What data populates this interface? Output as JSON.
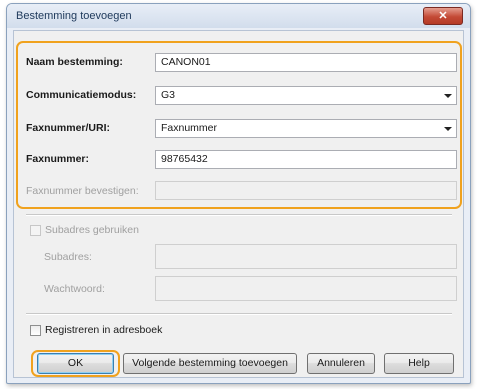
{
  "dialog": {
    "title": "Bestemming toevoegen",
    "close_label": "✕"
  },
  "form": {
    "name_label": "Naam bestemming:",
    "name_value": "CANON01",
    "mode_label": "Communicatiemodus:",
    "mode_value": "G3",
    "fax_uri_label": "Faxnummer/URI:",
    "fax_uri_value": "Faxnummer",
    "fax_label": "Faxnummer:",
    "fax_value": "98765432",
    "confirm_label": "Faxnummer bevestigen:",
    "confirm_value": ""
  },
  "subaddress": {
    "checkbox_label": "Subadres gebruiken",
    "subaddress_label": "Subadres:",
    "password_label": "Wachtwoord:",
    "checked": false,
    "enabled": false
  },
  "register": {
    "checkbox_label": "Registreren in adresboek",
    "checked": false
  },
  "buttons": {
    "ok": "OK",
    "add_next": "Volgende bestemming toevoegen",
    "cancel": "Annuleren",
    "help": "Help"
  },
  "colors": {
    "highlight": "#f0a21e",
    "close_button": "#c44a36",
    "title_text": "#1e395b"
  }
}
